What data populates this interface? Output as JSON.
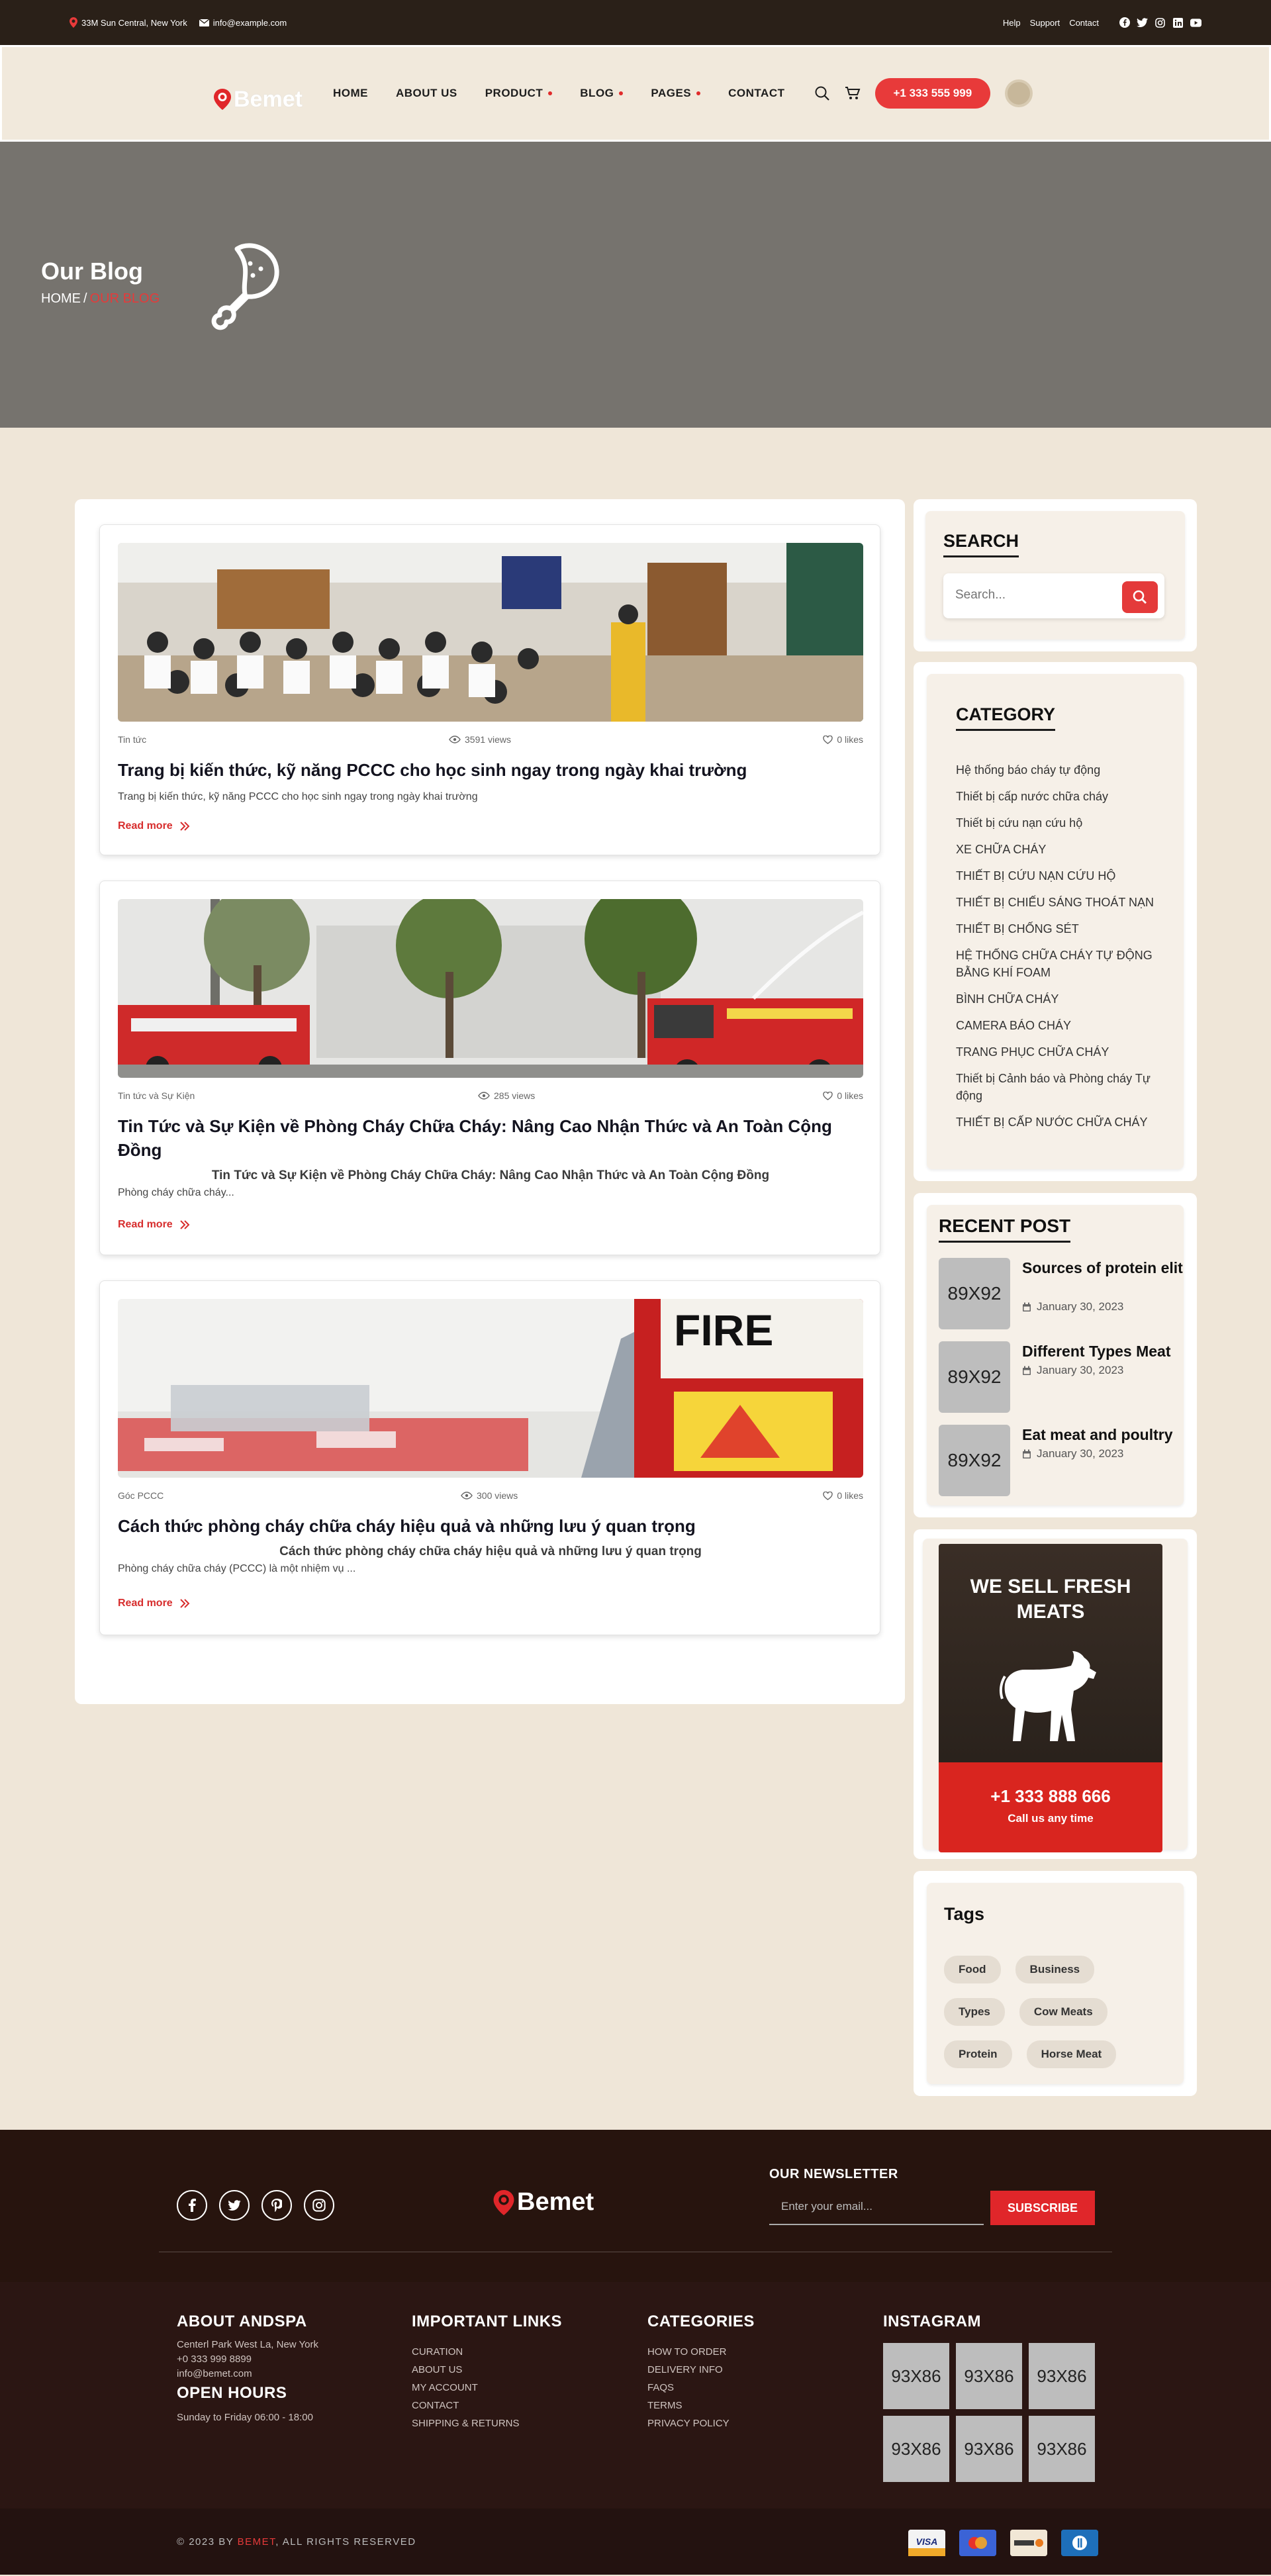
{
  "topbar": {
    "address": "33M Sun Central, New York",
    "email": "info@example.com",
    "links": [
      "Help",
      "Support",
      "Contact"
    ]
  },
  "header": {
    "logo": "Bemet",
    "nav": [
      "HOME",
      "ABOUT US",
      "PRODUCT",
      "BLOG",
      "PAGES",
      "CONTACT"
    ],
    "phone": "+1 333 555 999"
  },
  "banner": {
    "title": "Our Blog",
    "crumb_home": "HOME",
    "crumb_sep": "/",
    "crumb_current": "OUR BLOG"
  },
  "posts": [
    {
      "category": "Tin tức",
      "views": "3591 views",
      "likes": "0 likes",
      "title": "Trang bị kiến thức, kỹ năng PCCC cho học sinh ngay trong ngày khai trường",
      "subtitle": "",
      "desc": "Trang bị kiến thức, kỹ năng PCCC cho học sinh ngay trong ngày khai trường",
      "read_more": "Read more"
    },
    {
      "category": "Tin tức và Sự Kiện",
      "views": "285 views",
      "likes": "0 likes",
      "title": "Tin Tức và Sự Kiện về Phòng Cháy Chữa Cháy: Nâng Cao Nhận Thức và An Toàn Cộng Đồng",
      "subtitle": "Tin Tức và Sự Kiện về Phòng Cháy Chữa Cháy: Nâng Cao Nhận Thức và An Toàn Cộng Đồng",
      "desc": "Phòng cháy chữa cháy...",
      "read_more": "Read more"
    },
    {
      "category": "Góc PCCC",
      "views": "300 views",
      "likes": "0 likes",
      "title": "Cách thức phòng cháy chữa cháy hiệu quả và những lưu ý quan trọng",
      "subtitle": "Cách thức phòng cháy chữa cháy hiệu quả và những lưu ý quan trọng",
      "desc": "Phòng cháy chữa cháy (PCCC) là một nhiệm vụ ...",
      "read_more": "Read more"
    }
  ],
  "sidebar": {
    "search_title": "SEARCH",
    "search_placeholder": "Search...",
    "category_title": "CATEGORY",
    "categories": [
      "Hệ thống báo cháy tự động",
      "Thiết bị cấp nước chữa cháy",
      "Thiết bị cứu nạn cứu hộ",
      "XE CHỮA CHÁY",
      "THIẾT BỊ CỨU NẠN CỨU HỘ",
      "THIẾT BỊ CHIẾU SÁNG THOÁT NẠN",
      "THIẾT BỊ CHỐNG SÉT",
      "HỆ THỐNG CHỮA CHÁY TỰ ĐỘNG BẰNG KHÍ FOAM",
      "BÌNH CHỮA CHÁY",
      "CAMERA BÁO CHÁY",
      "TRANG PHỤC CHỮA CHÁY",
      "Thiết bị Cảnh báo và Phòng cháy Tự động",
      "THIẾT BỊ CẤP NƯỚC CHỮA CHÁY"
    ],
    "recent_title": "RECENT POST",
    "recent": [
      {
        "thumb": "89X92",
        "title": "Sources of protein elit",
        "date": "January 30, 2023"
      },
      {
        "thumb": "89X92",
        "title": "Different Types Meat",
        "date": "January 30, 2023"
      },
      {
        "thumb": "89X92",
        "title": "Eat meat and poultry",
        "date": "January 30, 2023"
      }
    ],
    "promo_headline": "WE SELL FRESH MEATS",
    "promo_phone": "+1 333 888 666",
    "promo_call": "Call us any time",
    "tags_title": "Tags",
    "tags": [
      "Food",
      "Business",
      "Types",
      "Cow Meats",
      "Protein",
      "Horse Meat"
    ]
  },
  "footer": {
    "logo": "Bemet",
    "newsletter_title": "OUR NEWSLETTER",
    "newsletter_placeholder": "Enter your email...",
    "subscribe": "SUBSCRIBE",
    "about_title": "ABOUT ANDSPA",
    "about_lines": [
      "Centerl Park West La, New York",
      "+0 333 999 8899",
      "info@bemet.com"
    ],
    "hours_title": "OPEN HOURS",
    "hours": "Sunday to Friday 06:00 - 18:00",
    "links_title": "IMPORTANT LINKS",
    "links": [
      "CURATION",
      "ABOUT US",
      "MY ACCOUNT",
      "CONTACT",
      "SHIPPING & RETURNS"
    ],
    "categories_title": "CATEGORIES",
    "categories": [
      "HOW TO ORDER",
      "DELIVERY INFO",
      "FAQS",
      "TERMS",
      "PRIVACY POLICY"
    ],
    "instagram_title": "INSTAGRAM",
    "instagram": [
      "93X86",
      "93X86",
      "93X86",
      "93X86",
      "93X86",
      "93X86"
    ],
    "copy_prefix": "© 2023 BY ",
    "copy_brand": "BEMET",
    "copy_suffix": ", ALL RIGHTS RESERVED",
    "payments": [
      "VISA",
      "MC",
      "DISCOVER",
      "DINERS"
    ]
  },
  "colors": {
    "accent": "#e83a3a",
    "dark": "#2a2018",
    "cream": "#f1e9dc",
    "footer": "#27140e"
  }
}
